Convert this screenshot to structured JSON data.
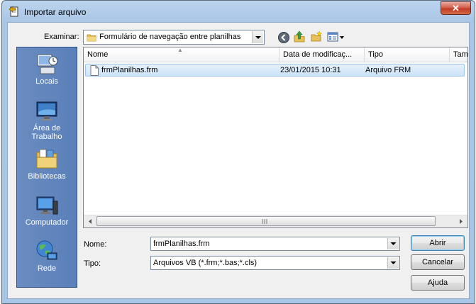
{
  "window": {
    "title": "Importar arquivo",
    "close_glyph": "✕"
  },
  "toolbar": {
    "lookin_label": "Examinar:",
    "lookin_value": "Formulário de navegação entre planilhas",
    "icons": [
      "back-icon",
      "up-folder-icon",
      "new-folder-icon",
      "view-menu-icon"
    ]
  },
  "places": [
    {
      "label": "Locais",
      "icon": "recent-places-icon"
    },
    {
      "label": "Área de\nTrabalho",
      "icon": "desktop-icon"
    },
    {
      "label": "Bibliotecas",
      "icon": "libraries-icon"
    },
    {
      "label": "Computador",
      "icon": "computer-icon"
    },
    {
      "label": "Rede",
      "icon": "network-icon"
    }
  ],
  "list": {
    "columns": [
      "Nome",
      "Data de modificaç...",
      "Tipo",
      "Tam"
    ],
    "rows": [
      {
        "name": "frmPlanilhas.frm",
        "date": "23/01/2015 10:31",
        "type": "Arquivo FRM",
        "selected": true
      }
    ]
  },
  "filename": {
    "label": "Nome:",
    "value": "frmPlanilhas.frm"
  },
  "filetype": {
    "label": "Tipo:",
    "value": "Arquivos VB (*.frm;*.bas;*.cls)"
  },
  "buttons": {
    "open": "Abrir",
    "cancel": "Cancelar",
    "help": "Ajuda"
  },
  "colors": {
    "places_panel": "#5a7fb9",
    "selection": "#cce3f8",
    "title_bar": "#a9c6e6",
    "close_button": "#c13b27"
  }
}
